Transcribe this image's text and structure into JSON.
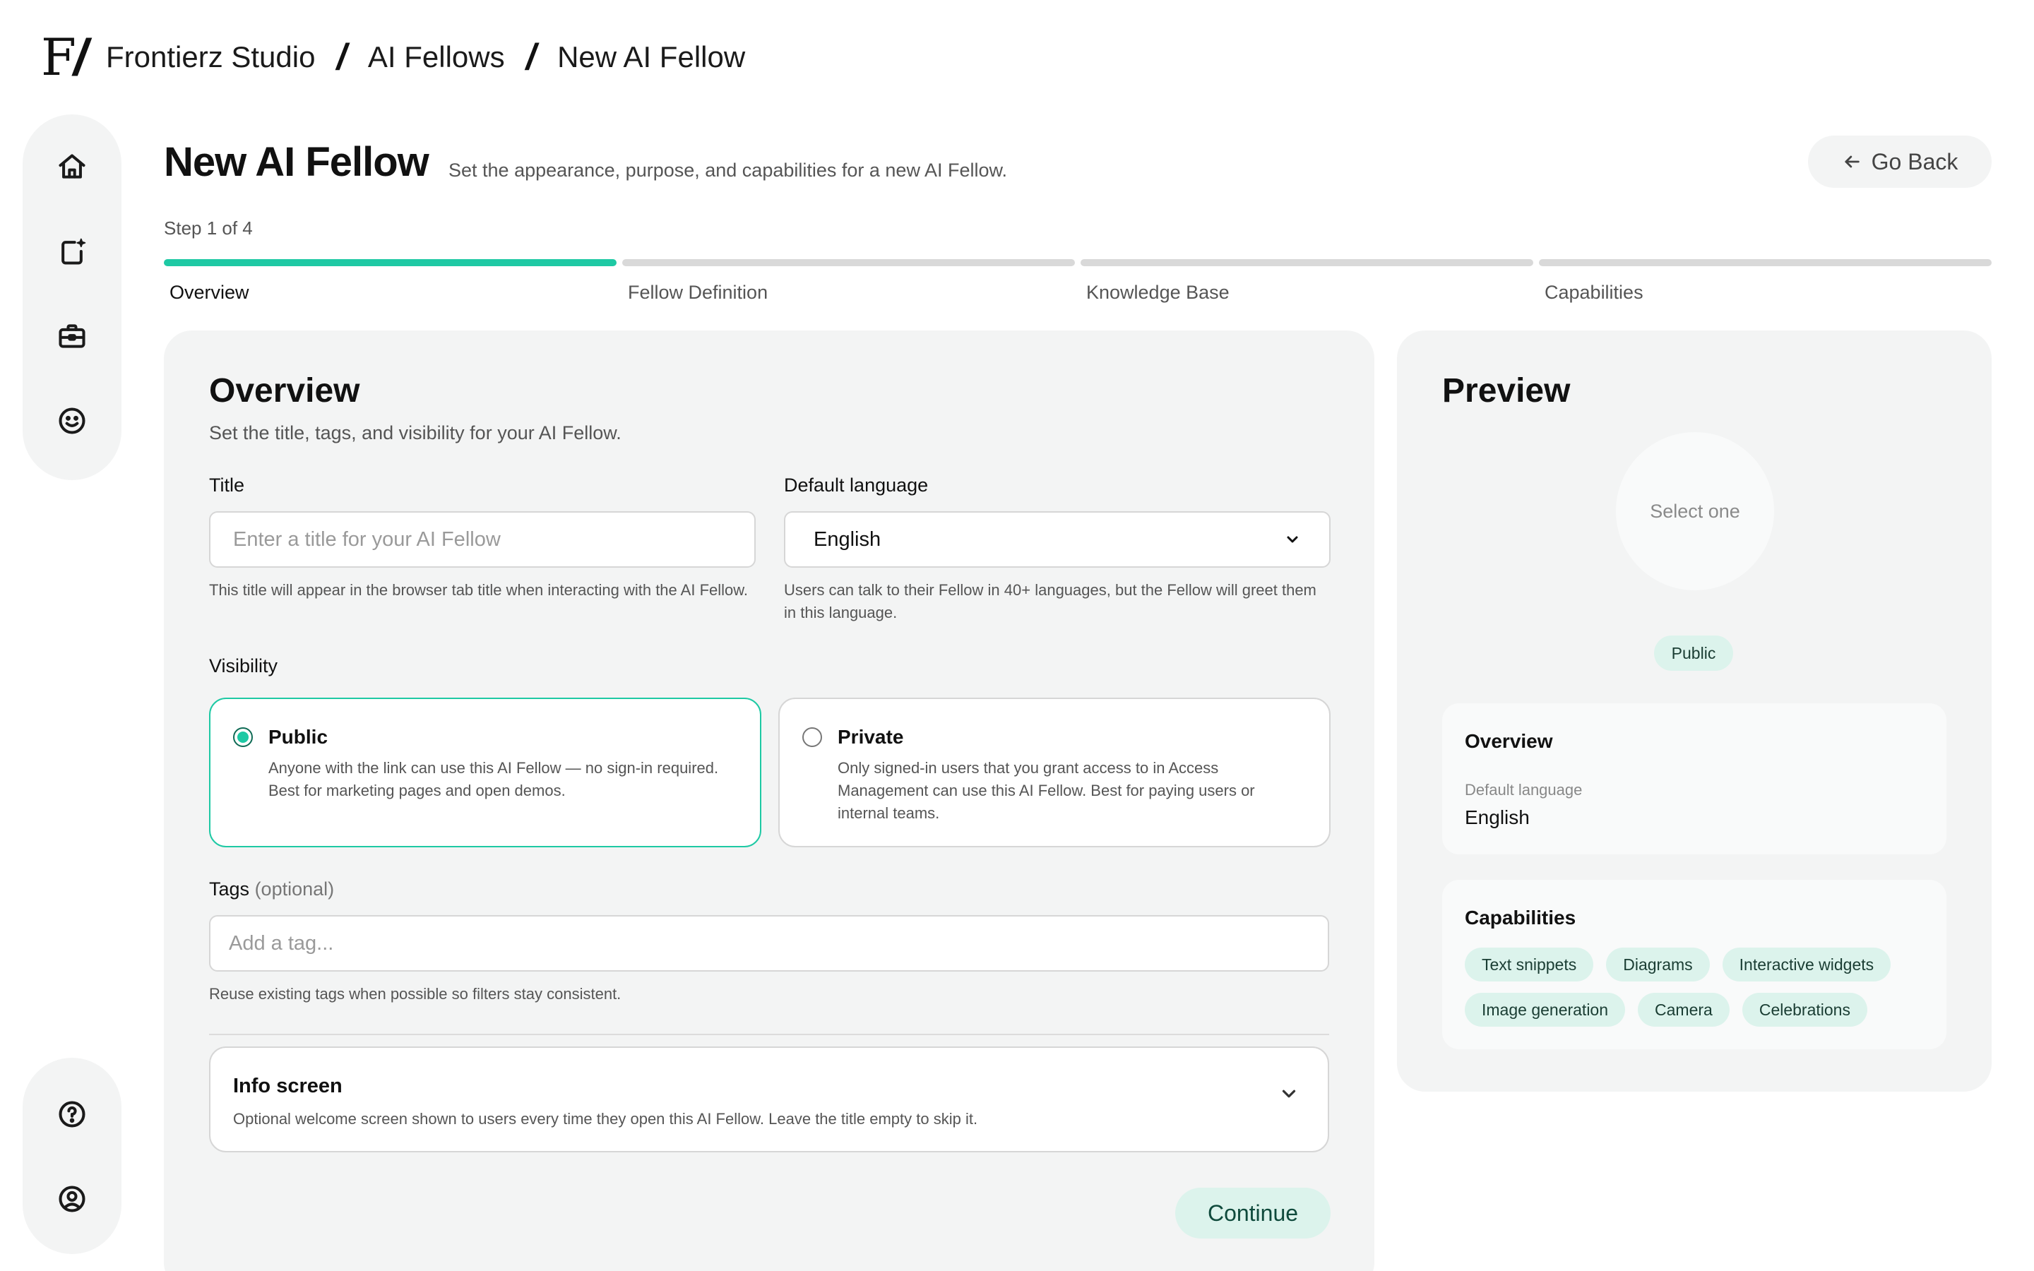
{
  "breadcrumb": {
    "logo": "F/",
    "items": [
      "Frontierz Studio",
      "AI Fellows",
      "New AI Fellow"
    ]
  },
  "header": {
    "title": "New AI Fellow",
    "subtitle": "Set the appearance, purpose, and capabilities for a new AI Fellow.",
    "go_back_label": "Go Back"
  },
  "stepper": {
    "count_label": "Step 1 of 4",
    "current": 1,
    "steps": [
      "Overview",
      "Fellow Definition",
      "Knowledge Base",
      "Capabilities"
    ]
  },
  "overview": {
    "heading": "Overview",
    "subheading": "Set the title, tags, and visibility for your AI Fellow.",
    "title_label": "Title",
    "title_placeholder": "Enter a title for your AI Fellow",
    "title_value": "",
    "title_help": "This title will appear in the browser tab title when interacting with the AI Fellow.",
    "language_label": "Default language",
    "language_value": "English",
    "language_help": "Users can talk to their Fellow in 40+ languages, but the Fellow will greet them in this language.",
    "visibility_label": "Visibility",
    "visibility_options": [
      {
        "title": "Public",
        "desc": "Anyone with the link can use this AI Fellow — no sign-in required. Best for marketing pages and open demos.",
        "selected": true
      },
      {
        "title": "Private",
        "desc": "Only signed-in users that you grant access to in Access Management can use this AI Fellow. Best for paying users or internal teams.",
        "selected": false
      }
    ],
    "tags_label": "Tags",
    "tags_optional": "(optional)",
    "tags_placeholder": "Add a tag...",
    "tags_help": "Reuse existing tags when possible so filters stay consistent.",
    "info_title": "Info screen",
    "info_desc": "Optional welcome screen shown to users every time they open this AI Fellow. Leave the title empty to skip it.",
    "continue_label": "Continue"
  },
  "preview": {
    "heading": "Preview",
    "avatar_placeholder": "Select one",
    "visibility_badge": "Public",
    "overview_heading": "Overview",
    "language_label": "Default language",
    "language_value": "English",
    "capabilities_heading": "Capabilities",
    "capabilities": [
      "Text snippets",
      "Diagrams",
      "Interactive widgets",
      "Image generation",
      "Camera",
      "Celebrations"
    ]
  },
  "rail": {
    "top_icons": [
      "home-icon",
      "new-post-icon",
      "briefcase-icon",
      "smiley-icon"
    ],
    "bottom_icons": [
      "help-icon",
      "user-icon"
    ]
  },
  "colors": {
    "accent": "#1ec9a4",
    "accent_soft": "#dcf3ec",
    "panel_bg": "#f3f4f4"
  }
}
